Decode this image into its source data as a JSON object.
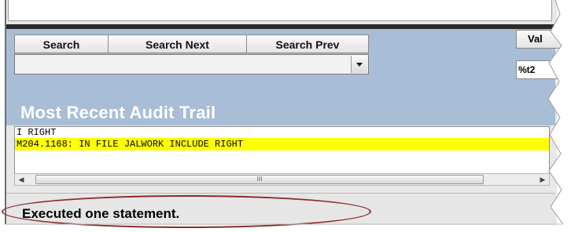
{
  "toolbar": {
    "search_label": "Search",
    "search_next_label": "Search Next",
    "search_prev_label": "Search Prev"
  },
  "right_panel": {
    "tab_label": "Val",
    "field_value": "%t2"
  },
  "audit": {
    "title": "Most Recent Audit Trail",
    "lines": [
      {
        "text": "I RIGHT",
        "highlighted": false
      },
      {
        "text": "M204.1168: IN FILE JALWORK INCLUDE RIGHT",
        "highlighted": true
      }
    ],
    "scroll_grip": "III"
  },
  "status": {
    "message": "Executed one statement."
  },
  "colors": {
    "panel_blue": "#a8bdd6",
    "highlight_yellow": "#ffff00",
    "annotation_ellipse": "#8b2a2a"
  }
}
